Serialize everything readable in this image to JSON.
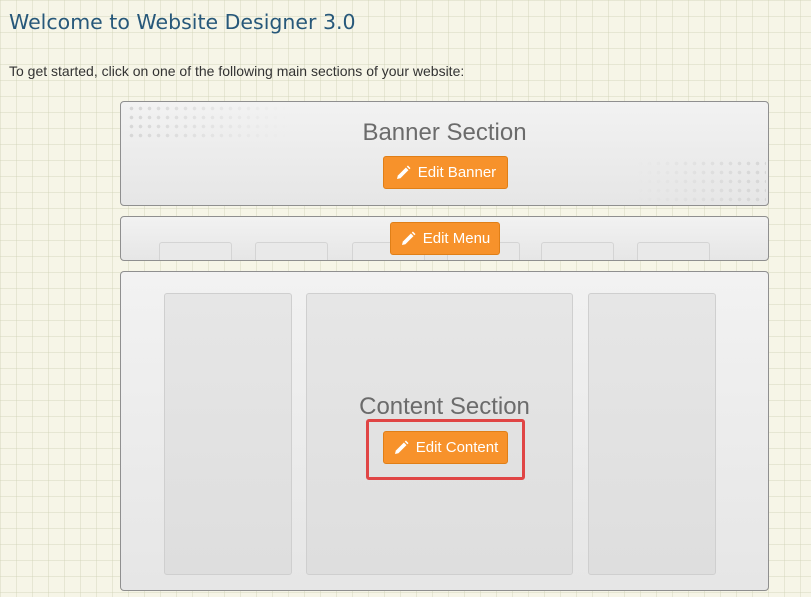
{
  "page": {
    "title": "Welcome to Website Designer 3.0",
    "intro": "To get started, click on one of the following main sections of your website:"
  },
  "banner": {
    "title": "Banner Section",
    "button_label": "Edit Banner",
    "button_icon": "pencil-icon"
  },
  "menu": {
    "button_label": "Edit Menu",
    "button_icon": "pencil-icon",
    "placeholder_tab_count": 6
  },
  "content": {
    "title": "Content Section",
    "button_label": "Edit Content",
    "button_icon": "pencil-icon"
  },
  "colors": {
    "title": "#27587a",
    "button": "#f7922b",
    "highlight": "#e04545",
    "section_text": "#6b6b6b"
  }
}
